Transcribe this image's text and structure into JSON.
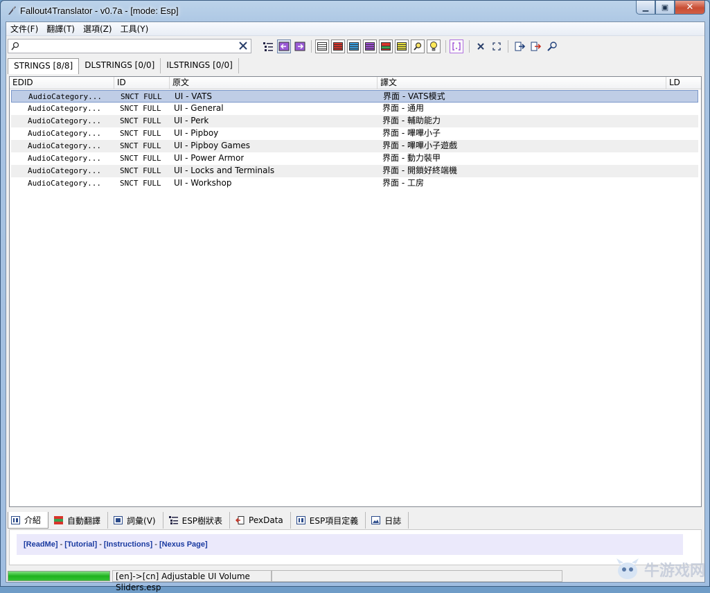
{
  "window": {
    "title": "Fallout4Translator - v0.7a - [mode: Esp]",
    "minimize": "▁",
    "maximize": "▣",
    "close": "✕"
  },
  "menu": [
    "文件(F)",
    "翻譯(T)",
    "選項(Z)",
    "工具(Y)"
  ],
  "search": {
    "value": "",
    "placeholder": ""
  },
  "tabs_top": [
    "STRINGS [8/8]",
    "DLSTRINGS [0/0]",
    "ILSTRINGS [0/0]"
  ],
  "table": {
    "columns": [
      "EDID",
      "ID",
      "原文",
      "譯文",
      "LD"
    ],
    "rows": [
      {
        "edid": "AudioCategory...",
        "id": "SNCT FULL",
        "source": "UI - VATS",
        "target": "界面 - VATS模式",
        "ld": ""
      },
      {
        "edid": "AudioCategory...",
        "id": "SNCT FULL",
        "source": "UI - General",
        "target": "界面 - 通用",
        "ld": ""
      },
      {
        "edid": "AudioCategory...",
        "id": "SNCT FULL",
        "source": "UI - Perk",
        "target": "界面 - 輔助能力",
        "ld": ""
      },
      {
        "edid": "AudioCategory...",
        "id": "SNCT FULL",
        "source": "UI - Pipboy",
        "target": "界面 - 嗶嗶小子",
        "ld": ""
      },
      {
        "edid": "AudioCategory...",
        "id": "SNCT FULL",
        "source": "UI - Pipboy Games",
        "target": "界面 - 嗶嗶小子遊戲",
        "ld": ""
      },
      {
        "edid": "AudioCategory...",
        "id": "SNCT FULL",
        "source": "UI - Power Armor",
        "target": "界面 - 動力裝甲",
        "ld": ""
      },
      {
        "edid": "AudioCategory...",
        "id": "SNCT FULL",
        "source": "UI - Locks and Terminals",
        "target": "界面 - 開鎖好終端機",
        "ld": ""
      },
      {
        "edid": "AudioCategory...",
        "id": "SNCT FULL",
        "source": "UI - Workshop",
        "target": "界面 - 工房",
        "ld": ""
      }
    ]
  },
  "tabs_bottom": [
    "介紹",
    "自動翻譯",
    "詞彙(V)",
    "ESP樹狀表",
    "PexData",
    "ESP項目定義",
    "日誌"
  ],
  "links": [
    "[ReadMe]",
    "[Tutorial]",
    "[Instructions]",
    "[Nexus Page]"
  ],
  "links_sep": " - ",
  "status": {
    "progress": 1.0,
    "text": "[en]->[cn] Adjustable UI Volume Sliders.esp"
  },
  "watermark": "牛游戏网",
  "colors": {
    "selected_row": "#bfcde6",
    "accent_purple": "#9b5bd6",
    "progress": "#1fb31f"
  }
}
